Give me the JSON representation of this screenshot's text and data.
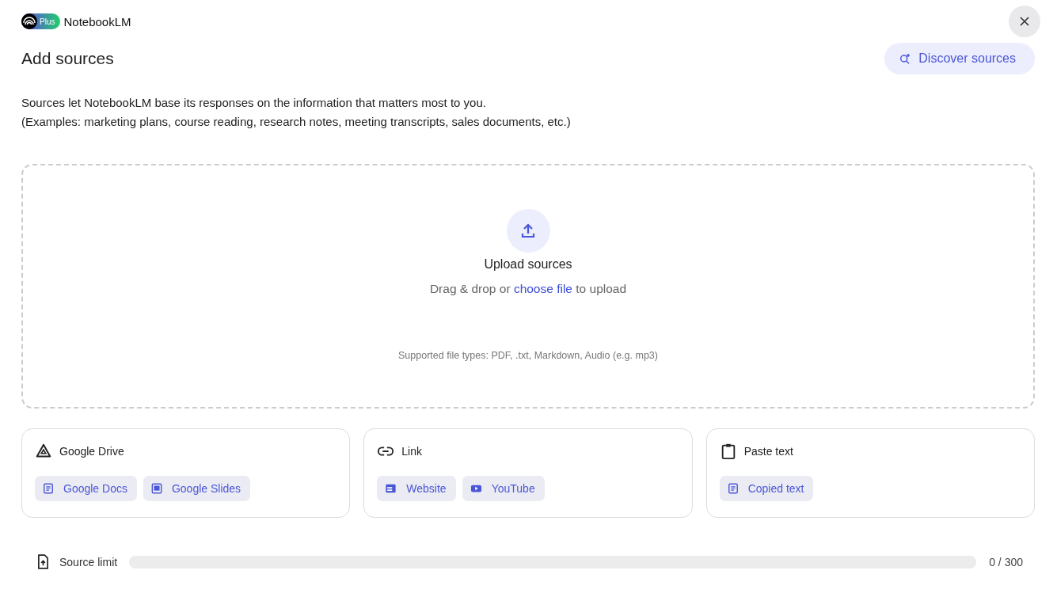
{
  "header": {
    "logo_badge": "Plus",
    "app_name": "NotebookLM"
  },
  "title": "Add sources",
  "discover_button": "Discover sources",
  "description": [
    "Sources let NotebookLM base its responses on the information that matters most to you.",
    "(Examples: marketing plans, course reading, research notes, meeting transcripts, sales documents, etc.)"
  ],
  "upload": {
    "title": "Upload sources",
    "hint_before": "Drag & drop or ",
    "hint_link": "choose file",
    "hint_after": " to upload",
    "supported": "Supported file types: PDF, .txt, Markdown, Audio (e.g. mp3)"
  },
  "cards": [
    {
      "kind": "drive",
      "title": "Google Drive",
      "chips": [
        {
          "kind": "doc",
          "label": "Google Docs"
        },
        {
          "kind": "slides",
          "label": "Google Slides"
        }
      ]
    },
    {
      "kind": "link",
      "title": "Link",
      "chips": [
        {
          "kind": "website",
          "label": "Website"
        },
        {
          "kind": "youtube",
          "label": "YouTube"
        }
      ]
    },
    {
      "kind": "paste",
      "title": "Paste text",
      "chips": [
        {
          "kind": "doc",
          "label": "Copied text"
        }
      ]
    }
  ],
  "source_limit": {
    "label": "Source limit",
    "level": 0,
    "reading": "0 / 300"
  }
}
